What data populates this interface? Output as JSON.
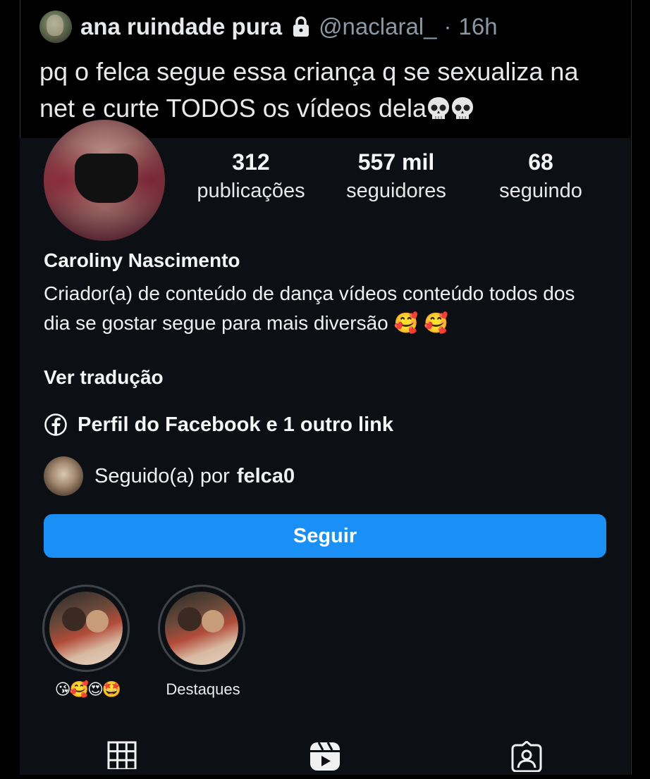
{
  "tweet": {
    "display_name": "ana ruindade pura",
    "handle": "@naclaral_",
    "separator": "·",
    "time": "16h",
    "text": "pq o felca segue essa criança q se sexualiza na net e curte TODOS os vídeos dela"
  },
  "profile": {
    "stats": [
      {
        "value": "312",
        "label": "publicações"
      },
      {
        "value": "557 mil",
        "label": "seguidores"
      },
      {
        "value": "68",
        "label": "seguindo"
      }
    ],
    "name": "Caroliny Nascimento",
    "bio": "Criador(a) de conteúdo de dança vídeos conteúdo todos dos dia se gostar segue para mais diversão 🥰 🥰",
    "see_translation": "Ver tradução",
    "link_text": "Perfil do Facebook e 1 outro link",
    "followed_by_prefix": "Seguido(a) por",
    "followed_by_user": "felca0",
    "follow_button": "Seguir",
    "highlights": [
      {
        "label": "😘🥰😍🤩"
      },
      {
        "label": "Destaques"
      }
    ]
  },
  "colors": {
    "follow_button": "#1a8ff6",
    "background": "#000000",
    "profile_background": "#0c0f14",
    "handle_gray": "#8b98a5"
  },
  "icons": [
    "lock-icon",
    "skull-emoji",
    "facebook-icon",
    "grid-icon",
    "reels-icon",
    "tagged-icon"
  ]
}
